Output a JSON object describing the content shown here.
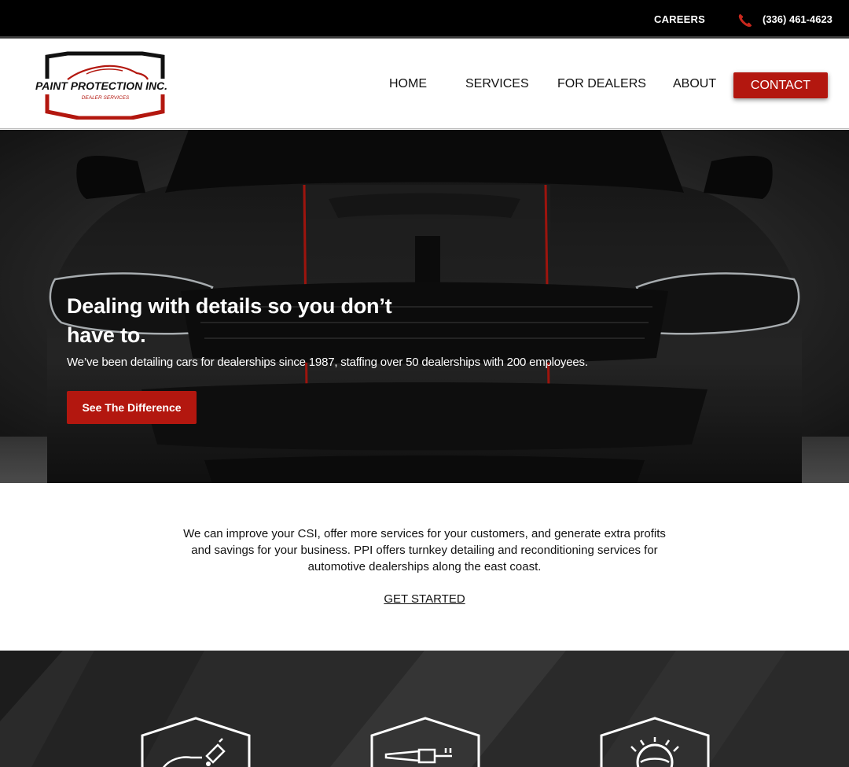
{
  "topbar": {
    "careers_label": "CAREERS",
    "phone_icon": "phone-icon",
    "phone": "(336) 461-4623"
  },
  "logo": {
    "name": "PAINT PROTECTION INC.",
    "tagline": "DEALER SERVICES"
  },
  "nav": {
    "home": "HOME",
    "services": "SERVICES",
    "dealers": "FOR DEALERS",
    "about": "ABOUT",
    "contact": "CONTACT"
  },
  "hero": {
    "headline": "Dealing with details so you don’t have to.",
    "subtext": "We’ve been detailing cars for dealerships since 1987, staffing over 50 dealerships with 200 employees.",
    "cta_label": "See The Difference"
  },
  "intro": {
    "text": "We can improve your CSI, offer more services for your customers, and generate extra profits and savings for your business. PPI offers turnkey detailing and reconditioning services for automotive dealerships along the east coast.",
    "link_label": "GET STARTED"
  },
  "services": {
    "badges": [
      {
        "icon": "hand-polish-icon"
      },
      {
        "icon": "paint-tube-icon"
      },
      {
        "icon": "steering-wheel-icon"
      }
    ]
  },
  "colors": {
    "accent": "#b3170f",
    "topbar": "#000000"
  }
}
